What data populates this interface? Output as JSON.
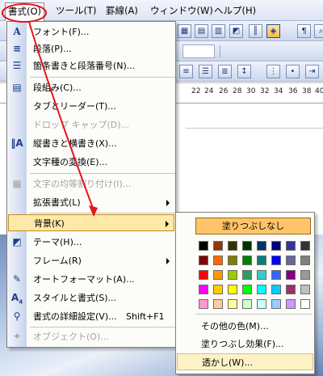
{
  "menubar": {
    "items": [
      {
        "label": "書式(O)",
        "active": true
      },
      {
        "label": "ツール(T)"
      },
      {
        "label": "罫線(A)"
      },
      {
        "label": "ウィンドウ(W)"
      },
      {
        "label": "ヘルプ(H)"
      }
    ]
  },
  "format_menu": {
    "items": [
      {
        "label": "フォント(F)...",
        "icon": "font-icon"
      },
      {
        "label": "段落(P)...",
        "icon": "paragraph-icon"
      },
      {
        "label": "箇条書きと段落番号(N)...",
        "icon": "bullets-icon"
      },
      {
        "label": "段組み(C)...",
        "icon": "columns-icon"
      },
      {
        "label": "タブとリーダー(T)...",
        "icon": ""
      },
      {
        "label": "ドロップ キャップ(D)...",
        "icon": "",
        "disabled": true
      },
      {
        "label": "縦書きと横書き(X)...",
        "icon": "text-direction-icon"
      },
      {
        "label": "文字種の変換(E)...",
        "icon": ""
      },
      {
        "label": "文字の均等割り付け(I)...",
        "icon": "distribute-icon",
        "disabled": true
      },
      {
        "label": "拡張書式(L)",
        "icon": "",
        "submenu": true
      },
      {
        "label": "背景(K)",
        "icon": "",
        "submenu": true,
        "selected": true
      },
      {
        "label": "テーマ(H)...",
        "icon": "theme-icon"
      },
      {
        "label": "フレーム(R)",
        "icon": "",
        "submenu": true
      },
      {
        "label": "オートフォーマット(A)...",
        "icon": "autoformat-icon"
      },
      {
        "label": "スタイルと書式(S)...",
        "icon": "styles-icon"
      },
      {
        "label": "書式の詳細設定(V)...",
        "icon": "reveal-formatting-icon",
        "shortcut": "Shift+F1"
      },
      {
        "label": "オブジェクト(O)...",
        "icon": "object-icon",
        "disabled": true
      }
    ]
  },
  "background_submenu": {
    "no_fill": "塗りつぶしなし",
    "colors": [
      [
        "#000000",
        "#993300",
        "#333300",
        "#003300",
        "#003366",
        "#000080",
        "#333399",
        "#333333"
      ],
      [
        "#800000",
        "#FF6600",
        "#808000",
        "#008000",
        "#008080",
        "#0000FF",
        "#666699",
        "#808080"
      ],
      [
        "#FF0000",
        "#FF9900",
        "#99CC00",
        "#339966",
        "#33CCCC",
        "#3366FF",
        "#800080",
        "#999999"
      ],
      [
        "#FF00FF",
        "#FFCC00",
        "#FFFF00",
        "#00FF00",
        "#00FFFF",
        "#00CCFF",
        "#993366",
        "#C0C0C0"
      ],
      [
        "#FF99CC",
        "#FFCC99",
        "#FFFF99",
        "#CCFFCC",
        "#CCFFFF",
        "#99CCFF",
        "#CC99FF",
        "#FFFFFF"
      ]
    ],
    "items": [
      {
        "label": "その他の色(M)..."
      },
      {
        "label": "塗りつぶし効果(F)..."
      },
      {
        "label": "透かし(W)...",
        "hot": true
      }
    ]
  },
  "ruler": {
    "numbers": [
      "22",
      "24",
      "26",
      "28",
      "30",
      "32",
      "34",
      "36",
      "38",
      "40"
    ]
  },
  "colors": {
    "annotation": "#e3141a",
    "menu_highlight": "#ffe9a8",
    "no_fill_button": "#ffc46a"
  }
}
